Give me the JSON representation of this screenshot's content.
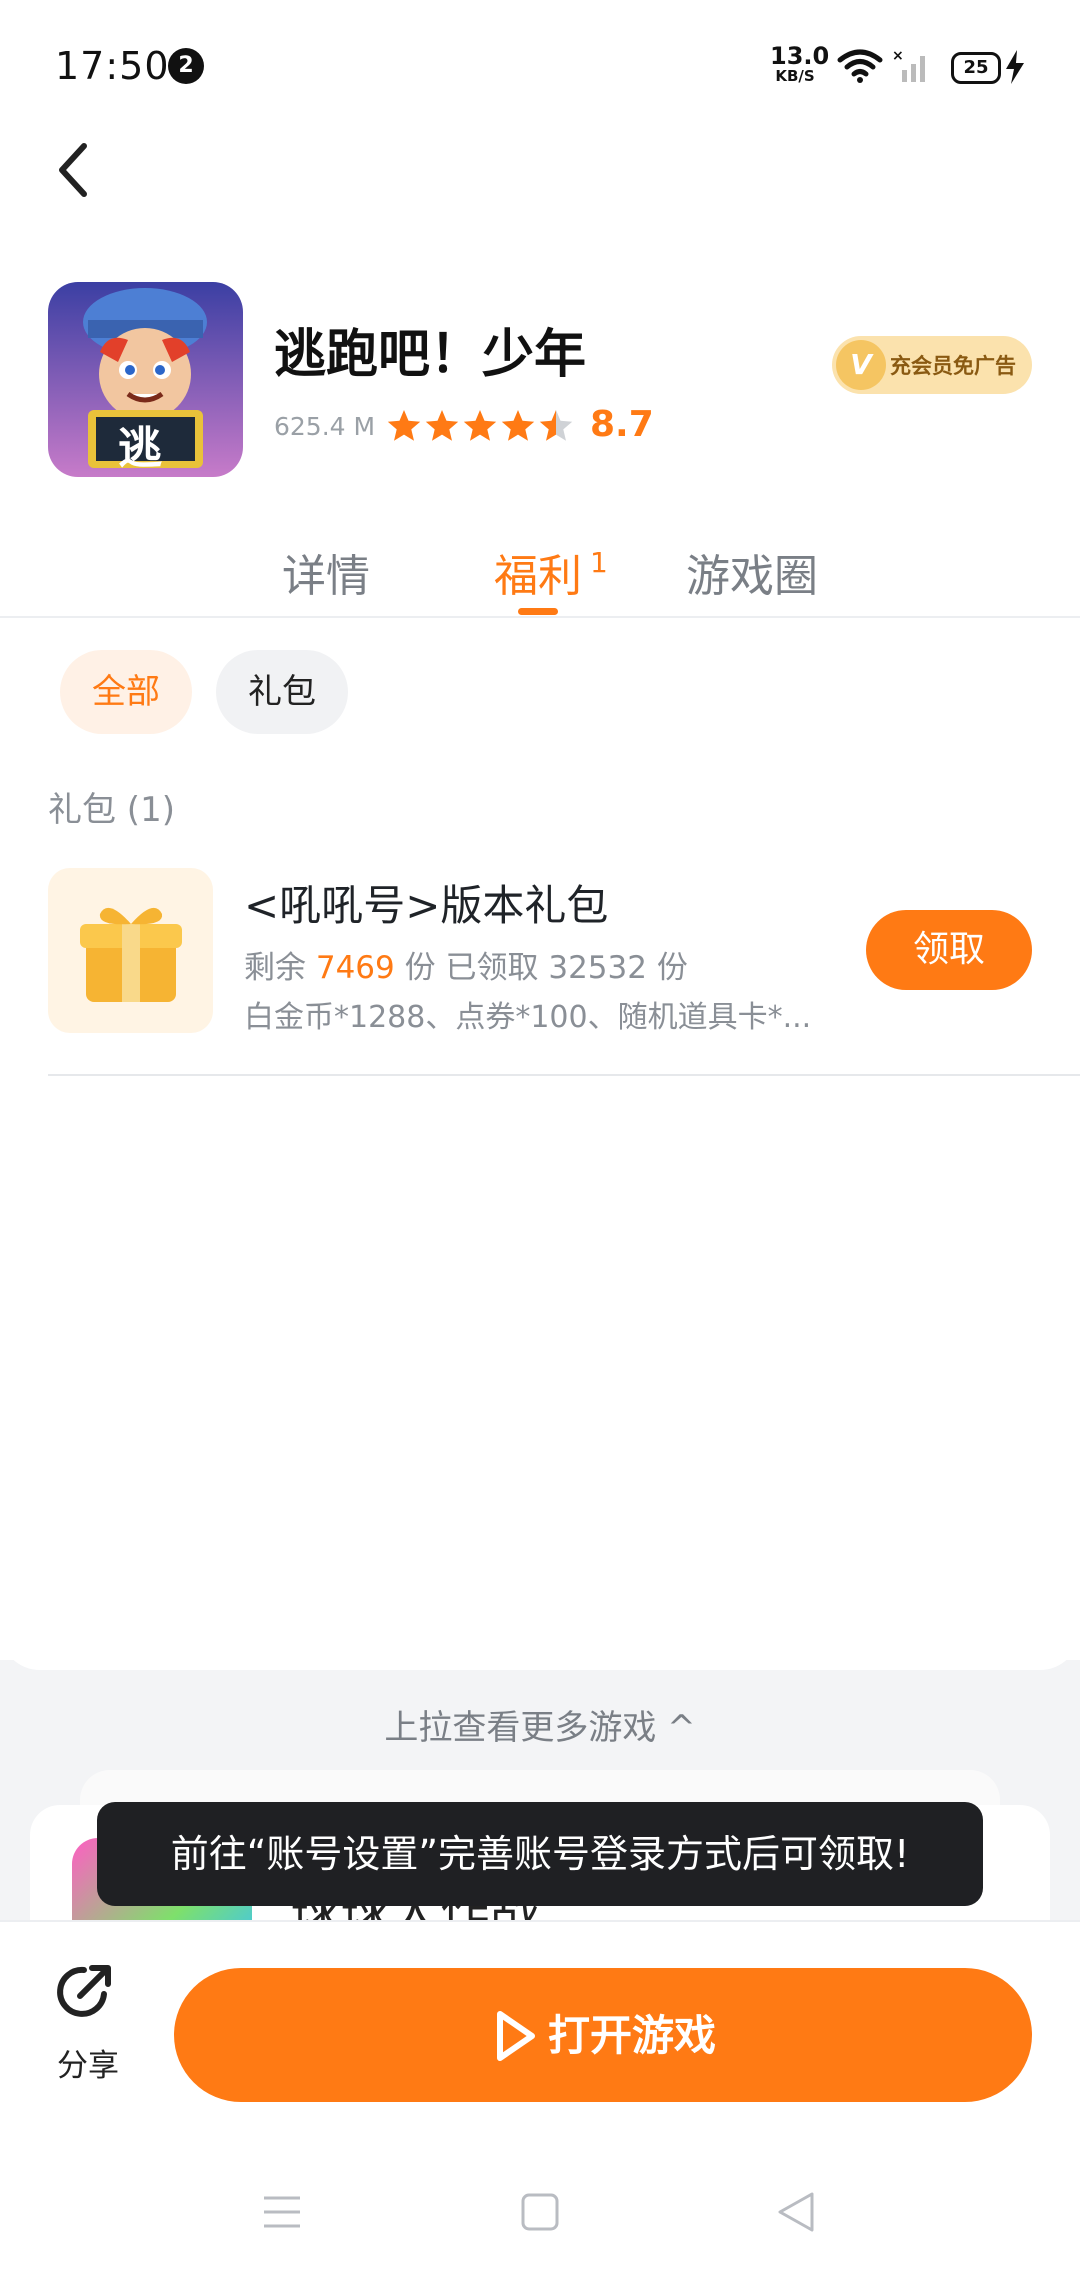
{
  "status_bar": {
    "time": "17:50",
    "notification_count": "2",
    "net_speed_value": "13.0",
    "net_speed_unit": "KB/S",
    "battery": "25"
  },
  "app": {
    "title": "逃跑吧！少年",
    "size": "625.4 M",
    "rating": "8.7",
    "rating_stars": 4.5,
    "vip_badge": "充会员免广告",
    "icon_glyph": "逃"
  },
  "tabs": [
    {
      "label": "详情",
      "count": ""
    },
    {
      "label": "福利",
      "count": "1"
    },
    {
      "label": "游戏圈",
      "count": ""
    }
  ],
  "filters": {
    "all": "全部",
    "gift": "礼包"
  },
  "section": {
    "title": "礼包 (1)"
  },
  "gift": {
    "name": "<吼吼号>版本礼包",
    "remaining_label": "剩余",
    "remaining": "7469",
    "unit": "份",
    "claimed_label": "已领取",
    "claimed": "32532",
    "description": "白金币*1288、点券*100、随机道具卡*...",
    "claim_label": "领取"
  },
  "more": {
    "pull_text": "上拉查看更多游戏 ^",
    "preview_title": "球球大作战"
  },
  "toast": "前往“账号设置”完善账号登录方式后可领取!",
  "bottom_bar": {
    "share_label": "分享",
    "open_label": "打开游戏"
  },
  "colors": {
    "accent": "#ff7a14",
    "muted": "#8a8f96",
    "vip_bg": "#fbe2ad"
  }
}
